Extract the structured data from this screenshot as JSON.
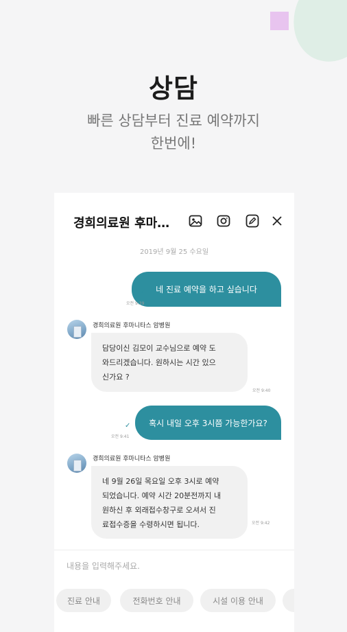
{
  "hero": {
    "title": "상담",
    "subtitle_line1": "빠른 상담부터 진료 예약까지",
    "subtitle_line2": "한번에!"
  },
  "chat": {
    "title": "경희의료원 후마…",
    "header_icons": [
      "image-icon",
      "camera-icon",
      "pencil-icon",
      "close-icon"
    ],
    "date": "2019년 9월 25 수요일",
    "messages": [
      {
        "type": "out",
        "text": "네 진료 예약을 하고 싶습니다",
        "time": "오전 9:39"
      },
      {
        "type": "in",
        "sender": "경희의료원 후마니타스 암병원",
        "lines": [
          "담당이신 김모이 교수님으로 예약 도",
          "와드리겠습니다. 원하시는 시간 있으",
          "신가요 ?"
        ],
        "time": "오전 9:40"
      },
      {
        "type": "out",
        "text": "혹시 내일 오후 3시쯤 가능한가요?",
        "time": "오전 9:41"
      },
      {
        "type": "in",
        "sender": "경희의료원 후마니타스 암병원",
        "lines": [
          "네 9월 26일 목요일 오후 3시로 예약",
          "되었습니다. 예약 시간 20분전까지 내",
          "원하신 후 외래접수창구로 오셔서 진",
          "료접수증을 수령하시면 됩니다."
        ],
        "time": "오전 9:42"
      }
    ],
    "input_placeholder": "내용을 입력해주세요.",
    "quick_replies": [
      "진료 안내",
      "전화번호 안내",
      "시설 이용 안내"
    ]
  },
  "colors": {
    "accent": "#2d8f9f",
    "background": "#f5f5f6",
    "bubble_in": "#f1f1f1",
    "deco_pink": "#e8c4ef",
    "deco_green": "#dfeee6"
  }
}
